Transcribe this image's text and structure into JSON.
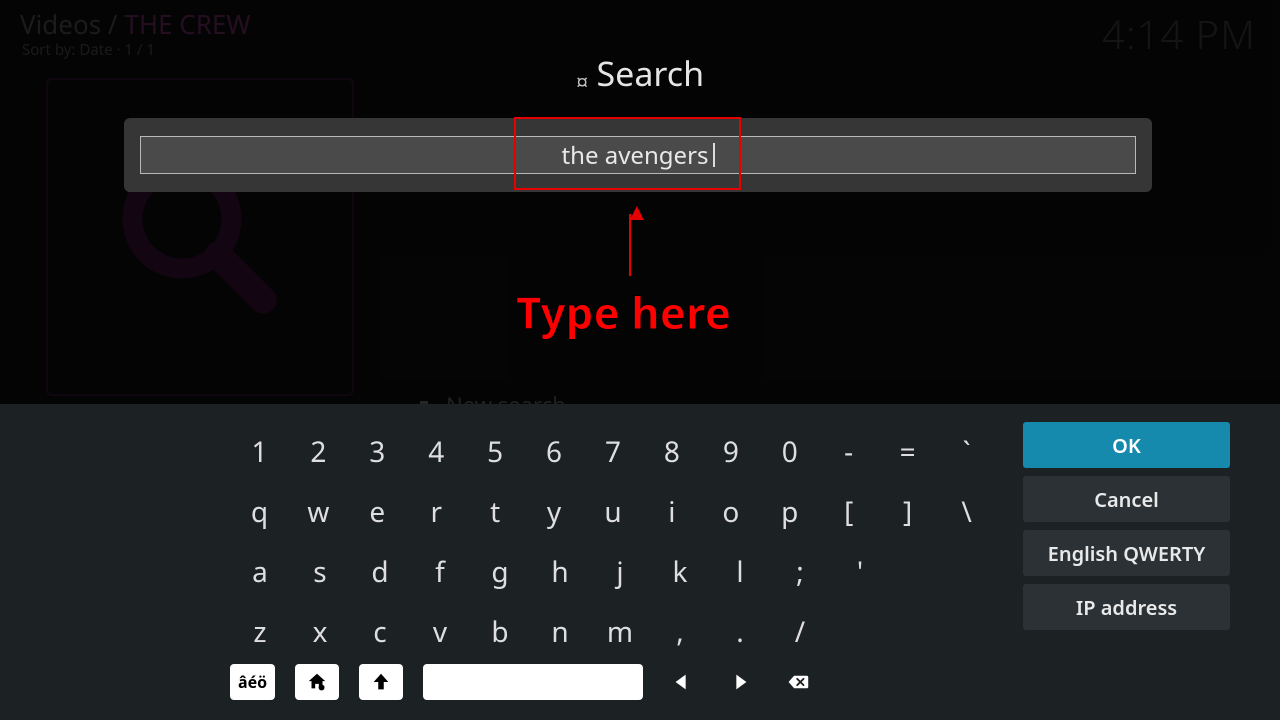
{
  "breadcrumb": {
    "root": "Videos",
    "sep": " / ",
    "current": "THE CREW"
  },
  "sort_line": "Sort by: Date  · 1 / 1",
  "clock": "4:14 PM",
  "list": {
    "new_search": "New search"
  },
  "dialog": {
    "title": "Search",
    "input_value": "the avengers"
  },
  "annotation": {
    "label": "Type here"
  },
  "keyboard": {
    "row1": [
      "1",
      "2",
      "3",
      "4",
      "5",
      "6",
      "7",
      "8",
      "9",
      "0",
      "-",
      "=",
      "`"
    ],
    "row2": [
      "q",
      "w",
      "e",
      "r",
      "t",
      "y",
      "u",
      "i",
      "o",
      "p",
      "[",
      "]",
      "\\"
    ],
    "row3": [
      "a",
      "s",
      "d",
      "f",
      "g",
      "h",
      "j",
      "k",
      "l",
      ";",
      "'"
    ],
    "row4": [
      "z",
      "x",
      "c",
      "v",
      "b",
      "n",
      "m",
      ",",
      ".",
      "/"
    ],
    "fn": {
      "accents": "âéö"
    }
  },
  "buttons": {
    "ok": "OK",
    "cancel": "Cancel",
    "layout": "English QWERTY",
    "ip": "IP address"
  }
}
